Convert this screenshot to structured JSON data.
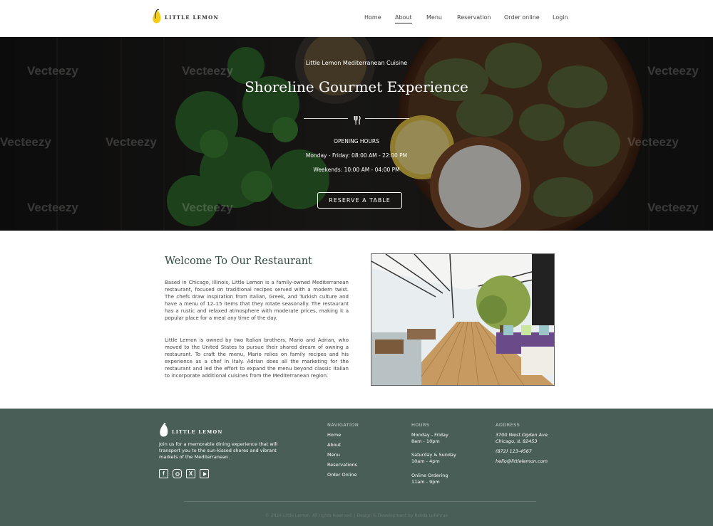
{
  "brand": {
    "name": "LITTLE LEMON",
    "icon": "lemon-icon"
  },
  "nav": {
    "items": [
      {
        "label": "Home",
        "active": false
      },
      {
        "label": "About",
        "active": true
      },
      {
        "label": "Menu",
        "active": false
      },
      {
        "label": "Reservation",
        "active": false
      },
      {
        "label": "Order online",
        "active": false
      },
      {
        "label": "Login",
        "active": false
      }
    ]
  },
  "hero": {
    "subtitle": "Little Lemon Mediterranean Cuisine",
    "title": "Shoreline Gourmet Experience",
    "divider_icon": "fork-knife-icon",
    "hours_label": "OPENING HOURS",
    "hours_weekdays": "Monday - Friday: 08:00 AM - 22:00 PM",
    "hours_weekends": "Weekends: 10:00 AM - 04:00 PM",
    "button": "RESERVE A TABLE",
    "watermark": "Vecteezy"
  },
  "welcome": {
    "title": "Welcome To Our Restaurant",
    "paragraph1": "Based in Chicago, Illinois, Little Lemon is a family-owned Mediterranean restaurant, focused on traditional recipes served with a modern twist. The chefs draw inspiration from Italian, Greek, and Turkish culture and have a menu of 12–15 items that they rotate seasonally. The restaurant has a rustic and relaxed atmosphere with moderate prices, making it a popular place for a meal any time of the day.",
    "paragraph2": "Little Lemon is owned by two Italian brothers, Mario and Adrian, who moved to the United States to pursue their shared dream of owning a restaurant. To craft the menu, Mario relies on family recipes and his experience as a chef in Italy. Adrian does all the marketing for the restaurant and led the effort to expand the menu beyond classic Italian to incorporate additional cuisines from the Mediterranean region."
  },
  "footer": {
    "brand": "LITTLE LEMON",
    "description": "Join us for a memorable dining experience that will transport you to the sun-kissed shores and vibrant markets of the Mediterranean.",
    "socials": [
      "facebook-icon",
      "instagram-icon",
      "x-icon",
      "youtube-icon"
    ],
    "navigation": {
      "heading": "NAVIGATION",
      "items": [
        "Home",
        "About",
        "Menu",
        "Reservations",
        "Order Online"
      ]
    },
    "hours": {
      "heading": "HOURS",
      "items": [
        {
          "days": "Monday - Friday",
          "time": "8am - 10pm"
        },
        {
          "days": "Saturday & Sunday",
          "time": "10am - 4pm"
        },
        {
          "days": "Online Ordering",
          "time": "11am - 9pm"
        }
      ]
    },
    "address": {
      "heading": "ADDRESS",
      "line1": "3700 West Ogden Ave.",
      "line2": "Chicago, IL 82453",
      "phone": "(872) 123-4567",
      "email": "hello@littlelemon.com"
    },
    "copyright": "© 2024 Little Lemon. All rights reserved.  |  Design & Development by Rolida Lefehrue"
  },
  "colors": {
    "primary": "#495e57",
    "accent": "#f4ce14",
    "heading": "#2e4a40"
  }
}
